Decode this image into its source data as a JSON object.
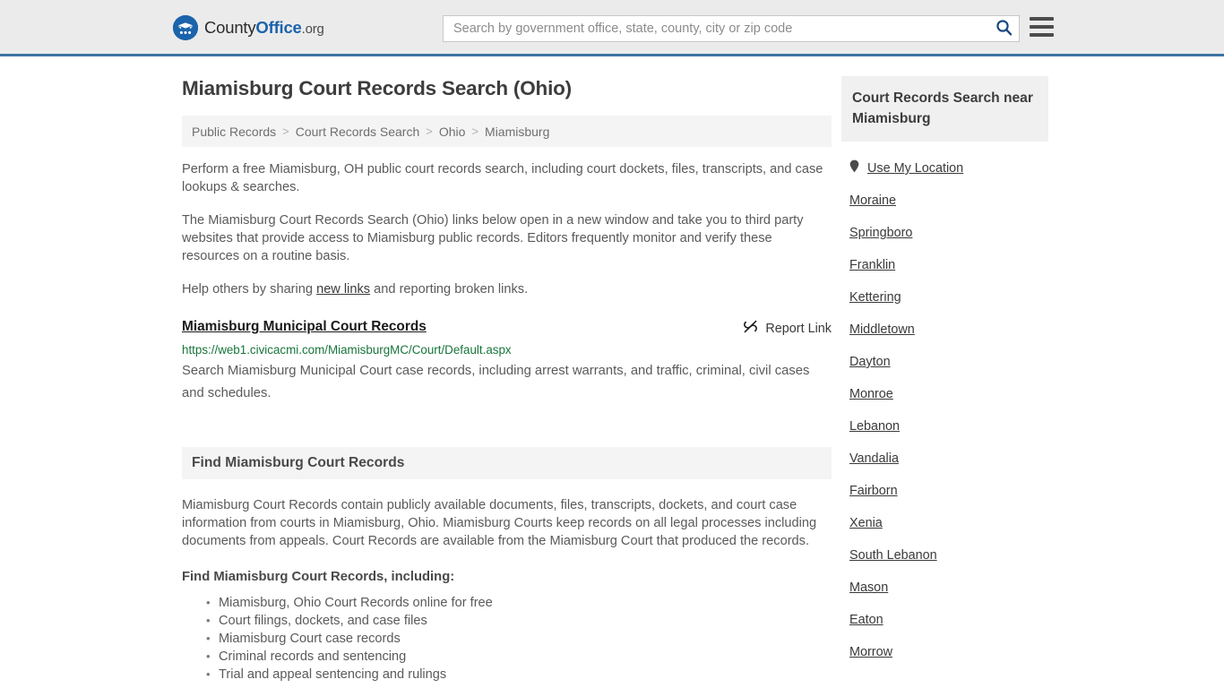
{
  "header": {
    "brand": {
      "part1": "County",
      "part2": "Office",
      "part3": ".org",
      "logo_icon": "eagle-stars-logo"
    },
    "search": {
      "placeholder": "Search by government office, state, county, city or zip code",
      "value": "",
      "icon": "search-icon"
    },
    "menu": {
      "icon": "hamburger-menu-icon",
      "label": "Menu"
    }
  },
  "main": {
    "title": "Miamisburg Court Records Search (Ohio)",
    "breadcrumb": {
      "items": [
        "Public Records",
        "Court Records Search",
        "Ohio",
        "Miamisburg"
      ],
      "separator": ">"
    },
    "intro": {
      "p1": "Perform a free Miamisburg, OH public court records search, including court dockets, files, transcripts, and case lookups & searches.",
      "p2": "The Miamisburg Court Records Search (Ohio) links below open in a new window and take you to third party websites that provide access to Miamisburg public records. Editors frequently monitor and verify these resources on a routine basis.",
      "p3_before": "Help others by sharing ",
      "p3_link": "new links",
      "p3_after": " and reporting broken links."
    },
    "result": {
      "title": "Miamisburg Municipal Court Records",
      "url": "https://web1.civicacmi.com/MiamisburgMC/Court/Default.aspx",
      "description": "Search Miamisburg Municipal Court case records, including arrest warrants, and traffic, criminal, civil cases and schedules.",
      "report_label": "Report Link",
      "report_icon": "broken-link-icon"
    },
    "section": {
      "heading": "Find Miamisburg Court Records",
      "paragraph": "Miamisburg Court Records contain publicly available documents, files, transcripts, dockets, and court case information from courts in Miamisburg, Ohio. Miamisburg Courts keep records on all legal processes including documents from appeals. Court Records are available from the Miamisburg Court that produced the records.",
      "subheading": "Find Miamisburg Court Records, including:",
      "bullets": [
        "Miamisburg, Ohio Court Records online for free",
        "Court filings, dockets, and case files",
        "Miamisburg Court case records",
        "Criminal records and sentencing",
        "Trial and appeal sentencing and rulings"
      ]
    }
  },
  "sidebar": {
    "heading": "Court Records Search near Miamisburg",
    "use_my_location": {
      "label": "Use My Location",
      "icon": "map-pin-icon"
    },
    "cities": [
      "Moraine",
      "Springboro",
      "Franklin",
      "Kettering",
      "Middletown",
      "Dayton",
      "Monroe",
      "Lebanon",
      "Vandalia",
      "Fairborn",
      "Xenia",
      "South Lebanon",
      "Mason",
      "Eaton",
      "Morrow"
    ]
  },
  "colors": {
    "header_bg": "#ebebeb",
    "header_border": "#3d74a5",
    "brand_blue": "#1b63ab",
    "url_green": "#18753c",
    "panel_gray": "#f4f4f4"
  }
}
